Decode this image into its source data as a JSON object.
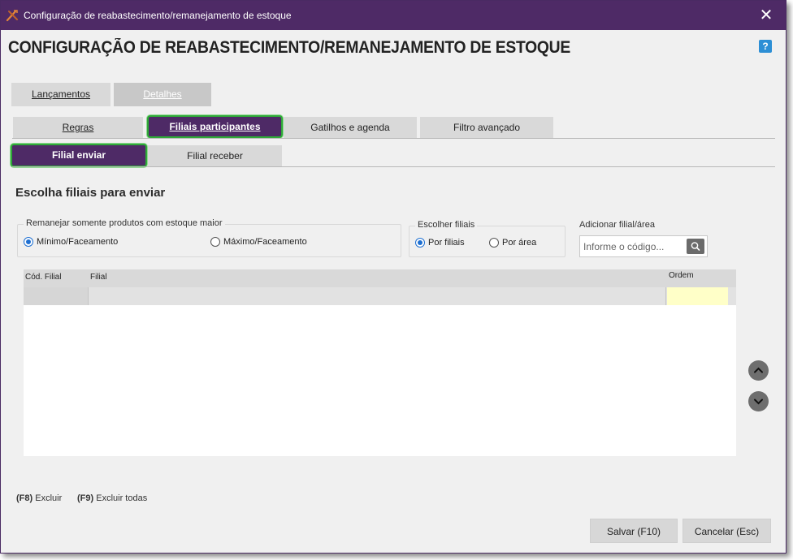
{
  "window": {
    "title": "Configuração de reabastecimento/remanejamento de estoque",
    "close_glyph": "✕",
    "app_icon": "cross-tools-icon"
  },
  "page": {
    "title": "CONFIGURAÇÃO DE REABASTECIMENTO/REMANEJAMENTO DE ESTOQUE",
    "help_glyph": "?"
  },
  "top_tabs": {
    "lancamentos": "Lançamentos",
    "detalhes": "Detalhes"
  },
  "sub_tabs": {
    "regras": "Regras",
    "filiais": "Filiais participantes",
    "gatilhos": "Gatilhos e agenda",
    "filtro": "Filtro avançado"
  },
  "inner_tabs": {
    "enviar": "Filial enviar",
    "receber": "Filial receber"
  },
  "section": {
    "title": "Escolha filiais para enviar"
  },
  "remanejar": {
    "label": "Remanejar somente produtos com estoque maior",
    "opt_min": "Mínimo/Faceamento",
    "opt_max": "Máximo/Faceamento"
  },
  "escolher": {
    "label": "Escolher filiais",
    "opt_filiais": "Por filiais",
    "opt_area": "Por área"
  },
  "adicionar": {
    "label": "Adicionar filial/área",
    "placeholder": "Informe o código..."
  },
  "grid": {
    "columns": [
      "Cód. Filial",
      "Filial",
      "Ordem"
    ]
  },
  "shortcuts": {
    "f8_key": "(F8)",
    "f8_label": "Excluir",
    "f9_key": "(F9)",
    "f9_label": "Excluir todas"
  },
  "footer": {
    "save": "Salvar (F10)",
    "cancel": "Cancelar (Esc)"
  },
  "colors": {
    "titlebar": "#4e2a66",
    "active_tab": "#4e2a66",
    "focus_border": "#2faa38",
    "radio_accent": "#1e6fd1"
  }
}
